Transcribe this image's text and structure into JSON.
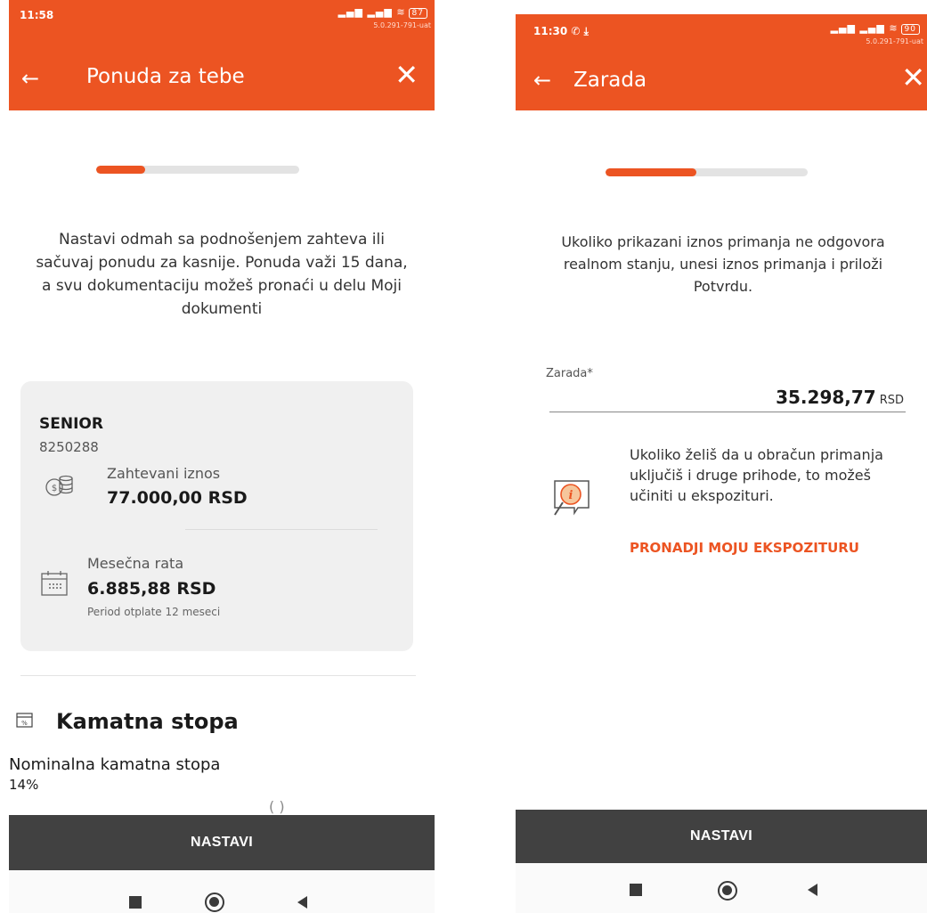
{
  "left_screen": {
    "status": {
      "time": "11:58",
      "battery": "87",
      "version": "5.0.291-791-uat"
    },
    "title": "Ponuda za tebe",
    "progress": 0.24,
    "intro": "Nastavi odmah sa podnošenjem zahteva ili sačuvaj ponudu za kasnije. Ponuda važi 15 dana, a svu dokumentaciju možeš pronaći u delu Moji dokumenti",
    "offer": {
      "product_name": "SENIOR",
      "product_code": "8250288",
      "requested_label": "Zahtevani iznos",
      "requested_value": "77.000,00 RSD",
      "monthly_label": "Mesečna rata",
      "monthly_value": "6.885,88 RSD",
      "period": "Period otplate 12 meseci"
    },
    "interest": {
      "section_title": "Kamatna stopa",
      "nominal_label": "Nominalna kamatna stopa",
      "nominal_value": "14%",
      "peek_text": "( )"
    },
    "cta": "NASTAVI"
  },
  "right_screen": {
    "status": {
      "time": "11:30",
      "battery": "90",
      "version": "5.0.291-791-uat"
    },
    "title": "Zarada",
    "progress": 0.45,
    "intro": "Ukoliko prikazani iznos primanja ne odgovora realnom stanju, unesi iznos primanja i priloži Potvrdu.",
    "salary_field": {
      "label": "Zarada*",
      "value": "35.298,77",
      "currency": "RSD"
    },
    "info_text": "Ukoliko želiš da u obračun primanja uključiš i druge prihode, to možeš učiniti u ekspozituri.",
    "info_link": "PRONADJI MOJU EKSPOZITURU",
    "cta": "NASTAVI"
  },
  "colors": {
    "accent": "#ec5422",
    "cta_bg": "#414141",
    "card_bg": "#f0f0f0",
    "track": "#e3e3e3"
  },
  "icons": [
    "back-arrow",
    "close-x",
    "coins",
    "calendar",
    "percent-calendar",
    "info-magnifier",
    "nav-square",
    "nav-circle",
    "nav-triangle"
  ]
}
